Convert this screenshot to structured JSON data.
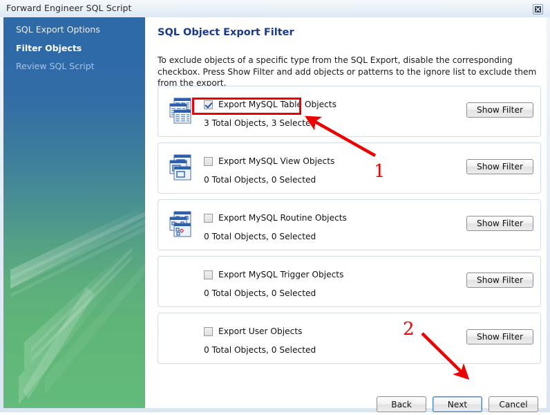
{
  "window": {
    "title": "Forward Engineer SQL Script",
    "close_icon": "close-icon"
  },
  "sidebar": {
    "items": [
      {
        "label": "SQL Export Options",
        "state": "done"
      },
      {
        "label": "Filter Objects",
        "state": "current"
      },
      {
        "label": "Review SQL Script",
        "state": "future"
      }
    ]
  },
  "content": {
    "title": "SQL Object Export Filter",
    "description": "To exclude objects of a specific type from the SQL Export, disable the corresponding checkbox. Press Show Filter and add objects or patterns to the ignore list to exclude them from the export.",
    "panels": [
      {
        "icon": "table-objects-icon",
        "checkbox_label": "Export MySQL Table Objects",
        "checked": true,
        "stats": "3 Total Objects, 3 Selected",
        "button_label": "Show Filter",
        "highlighted": true
      },
      {
        "icon": "view-objects-icon",
        "checkbox_label": "Export MySQL View Objects",
        "checked": false,
        "stats": "0 Total Objects, 0 Selected",
        "button_label": "Show Filter",
        "highlighted": false
      },
      {
        "icon": "routine-objects-icon",
        "checkbox_label": "Export MySQL Routine Objects",
        "checked": false,
        "stats": "0 Total Objects, 0 Selected",
        "button_label": "Show Filter",
        "highlighted": false
      },
      {
        "icon": "none",
        "checkbox_label": "Export MySQL Trigger Objects",
        "checked": false,
        "stats": "0 Total Objects, 0 Selected",
        "button_label": "Show Filter",
        "highlighted": false
      },
      {
        "icon": "none",
        "checkbox_label": "Export User Objects",
        "checked": false,
        "stats": "0 Total Objects, 0 Selected",
        "button_label": "Show Filter",
        "highlighted": false
      }
    ]
  },
  "footer": {
    "back_label": "Back",
    "next_label": "Next",
    "cancel_label": "Cancel"
  },
  "annotations": {
    "marker_one": "1",
    "marker_two": "2",
    "color": "#ee0000"
  },
  "colors": {
    "title_blue": "#1a3a8f",
    "sidebar_top": "#2f6aa8",
    "sidebar_bottom": "#63bb7b",
    "annotation_red": "#ee0000"
  }
}
